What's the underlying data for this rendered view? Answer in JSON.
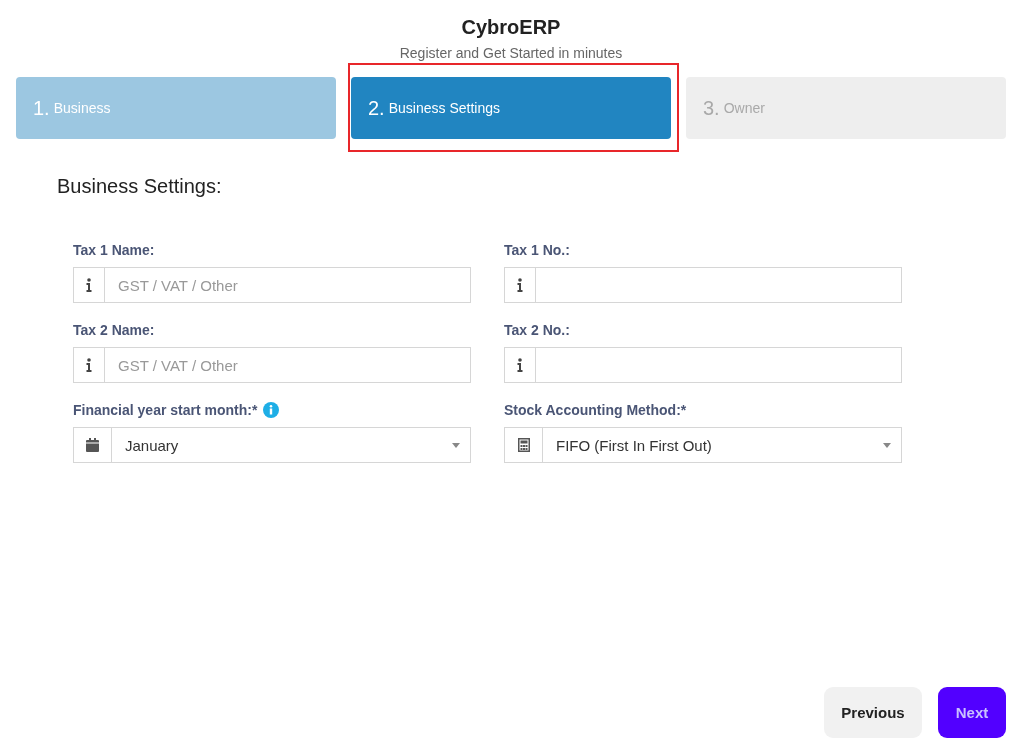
{
  "header": {
    "title": "CybroERP",
    "subtitle": "Register and Get Started in minutes"
  },
  "steps": [
    {
      "number": "1.",
      "label": "Business",
      "done": true,
      "selected": false,
      "highlighted": false
    },
    {
      "number": "2.",
      "label": "Business Settings",
      "done": false,
      "selected": true,
      "highlighted": true
    },
    {
      "number": "3.",
      "label": "Owner",
      "done": false,
      "selected": false,
      "highlighted": false
    }
  ],
  "section_title": "Business Settings:",
  "fields": [
    {
      "label": "Tax 1 Name:",
      "info": false,
      "kind": "text",
      "placeholder": "GST / VAT / Other"
    },
    {
      "label": "Tax 1 No.:",
      "info": false,
      "kind": "text"
    },
    {
      "label": "Tax 2 Name:",
      "info": false,
      "kind": "text",
      "placeholder": "GST / VAT / Other"
    },
    {
      "label": "Tax 2 No.:",
      "info": false,
      "kind": "text"
    },
    {
      "label": "Financial year start month:*",
      "info": true,
      "kind": "month",
      "value": "January"
    },
    {
      "label": "Stock Accounting Method:*",
      "info": false,
      "kind": "method",
      "value": "FIFO (First In First Out)"
    }
  ],
  "buttons": [
    {
      "label": "Previous",
      "kind": "secondary"
    },
    {
      "label": "Next",
      "kind": "primary"
    }
  ]
}
